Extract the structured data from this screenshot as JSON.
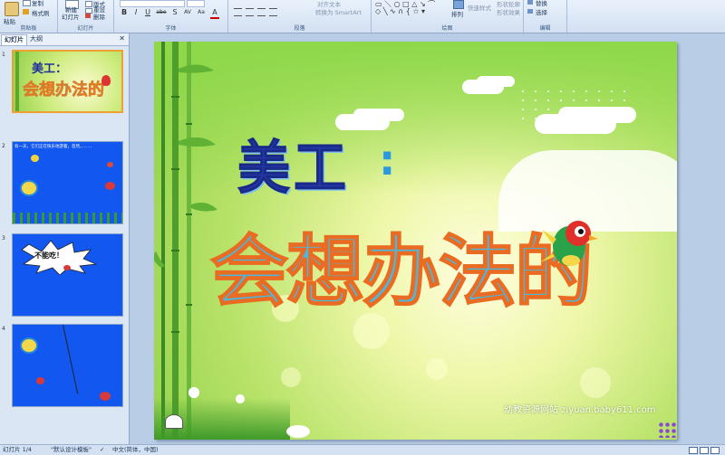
{
  "ribbon": {
    "clipboard": {
      "paste": "粘贴",
      "copy": "复制",
      "format_painter": "格式刷",
      "group_label": "剪贴板"
    },
    "slides": {
      "new_slide_line1": "新建",
      "new_slide_line2": "幻灯片",
      "layout": "版式",
      "reset": "重设",
      "delete": "删除",
      "group_label": "幻灯片"
    },
    "font": {
      "bold": "B",
      "italic": "I",
      "underline": "U",
      "strike": "abe",
      "shadow": "S",
      "spacing": "AV",
      "case": "Aa",
      "color": "A",
      "group_label": "字体"
    },
    "paragraph": {
      "convert_smartart": "转换为 SmartArt",
      "align_text": "对齐文本",
      "group_label": "段落"
    },
    "drawing": {
      "arrange": "排列",
      "quick_styles": "快速样式",
      "shape_outline": "形状轮廓",
      "shape_effects": "形状效果",
      "group_label": "绘图"
    },
    "editing": {
      "replace": "替换",
      "select": "选择",
      "group_label": "编辑"
    }
  },
  "panel": {
    "tab_slides": "幻灯片",
    "tab_outline": "大纲",
    "thumbs": [
      {
        "num": "1",
        "title_small": "美工：",
        "title_big": "会想办法的"
      },
      {
        "num": "2",
        "caption": "有一天，它们正在快乐地游着，忽然，．．．．．"
      },
      {
        "num": "3",
        "bubble": "不能吃！"
      },
      {
        "num": "4"
      }
    ]
  },
  "slide": {
    "title_small": "美工",
    "title_colon": ":",
    "title_big": "会想办法的",
    "watermark": "幼教资源网站  ziyuan.baby611.com"
  },
  "status": {
    "slide_count": "幻灯片 1/4",
    "theme": "\"默认设计模板\"",
    "language": "中文(简体，中国)"
  }
}
